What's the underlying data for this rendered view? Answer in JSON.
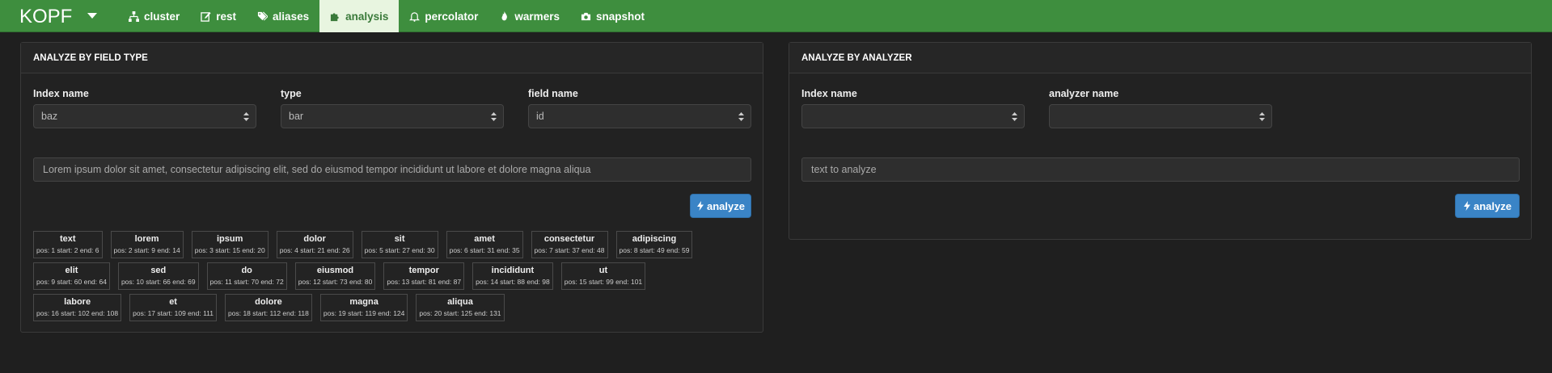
{
  "brand": "KOPF",
  "nav": [
    {
      "label": "cluster",
      "icon": "sitemap-icon"
    },
    {
      "label": "rest",
      "icon": "edit-icon"
    },
    {
      "label": "aliases",
      "icon": "tags-icon"
    },
    {
      "label": "analysis",
      "icon": "puzzle-icon",
      "active": true
    },
    {
      "label": "percolator",
      "icon": "bell-icon"
    },
    {
      "label": "warmers",
      "icon": "fire-icon"
    },
    {
      "label": "snapshot",
      "icon": "camera-icon"
    }
  ],
  "field_panel": {
    "title": "ANALYZE BY FIELD TYPE",
    "index_label": "Index name",
    "index_value": "baz",
    "type_label": "type",
    "type_value": "bar",
    "field_label": "field name",
    "field_value": "id",
    "text_value": "Lorem ipsum dolor sit amet, consectetur adipiscing elit, sed do eiusmod tempor incididunt ut labore et dolore magna aliqua",
    "button_label": "analyze",
    "token_rows": [
      [
        {
          "term": "text",
          "info": "pos: 1 start: 2 end: 6"
        },
        {
          "term": "lorem",
          "info": "pos: 2 start: 9 end: 14"
        },
        {
          "term": "ipsum",
          "info": "pos: 3 start: 15 end: 20"
        },
        {
          "term": "dolor",
          "info": "pos: 4 start: 21 end: 26"
        },
        {
          "term": "sit",
          "info": "pos: 5 start: 27 end: 30"
        },
        {
          "term": "amet",
          "info": "pos: 6 start: 31 end: 35"
        },
        {
          "term": "consectetur",
          "info": "pos: 7 start: 37 end: 48"
        },
        {
          "term": "adipiscing",
          "info": "pos: 8 start: 49 end: 59"
        }
      ],
      [
        {
          "term": "elit",
          "info": "pos: 9 start: 60 end: 64"
        },
        {
          "term": "sed",
          "info": "pos: 10 start: 66 end: 69"
        },
        {
          "term": "do",
          "info": "pos: 11 start: 70 end: 72"
        },
        {
          "term": "eiusmod",
          "info": "pos: 12 start: 73 end: 80"
        },
        {
          "term": "tempor",
          "info": "pos: 13 start: 81 end: 87"
        },
        {
          "term": "incididunt",
          "info": "pos: 14 start: 88 end: 98"
        },
        {
          "term": "ut",
          "info": "pos: 15 start: 99 end: 101"
        }
      ],
      [
        {
          "term": "labore",
          "info": "pos: 16 start: 102 end: 108"
        },
        {
          "term": "et",
          "info": "pos: 17 start: 109 end: 111"
        },
        {
          "term": "dolore",
          "info": "pos: 18 start: 112 end: 118"
        },
        {
          "term": "magna",
          "info": "pos: 19 start: 119 end: 124"
        },
        {
          "term": "aliqua",
          "info": "pos: 20 start: 125 end: 131"
        }
      ]
    ]
  },
  "analyzer_panel": {
    "title": "ANALYZE BY ANALYZER",
    "index_label": "Index name",
    "index_value": "",
    "analyzer_label": "analyzer name",
    "analyzer_value": "",
    "text_placeholder": "text to analyze",
    "button_label": "analyze"
  },
  "colors": {
    "navbar": "#3e8e3e",
    "active_tab_bg": "#e8f5e0",
    "button": "#3a84c6",
    "background": "#1f1f1f"
  }
}
